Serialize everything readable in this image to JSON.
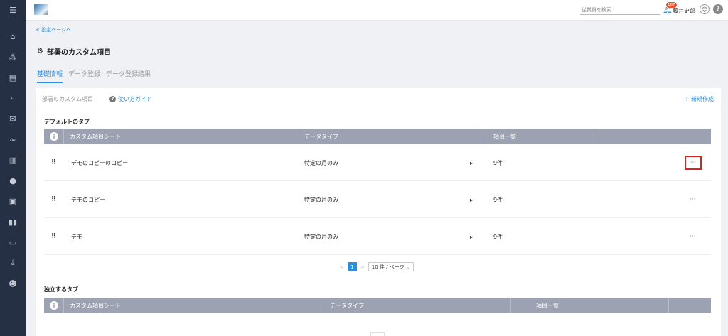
{
  "rail": {
    "icons": [
      "menu-icon",
      "home-icon",
      "org-chart-icon",
      "document-icon",
      "search-icon",
      "chat-icon",
      "link-icon",
      "chart-icon",
      "info-icon",
      "contact-card-icon",
      "book-icon",
      "mail-icon",
      "download-icon",
      "user-settings-icon"
    ]
  },
  "header": {
    "search_placeholder": "従業員を検索",
    "notification_count": "187",
    "user_name": "藤井史郎"
  },
  "breadcrumb": {
    "back_label": "< 設定ページへ"
  },
  "page": {
    "title": "部署のカスタム項目"
  },
  "tabs": [
    {
      "label": "基礎情報",
      "active": true
    },
    {
      "label": "データ登録",
      "active": false
    },
    {
      "label": "データ登録結果",
      "active": false
    }
  ],
  "card": {
    "title": "部署のカスタム項目",
    "guide_label": "使い方ガイド",
    "new_label": "+ 新規作成"
  },
  "default_section": {
    "title": "デフォルトのタブ",
    "columns": [
      "カスタム項目シート",
      "データタイプ",
      "項目一覧"
    ],
    "rows": [
      {
        "name": "デモのコピーのコピー",
        "type": "特定の月のみ",
        "count": "9件",
        "more": "···"
      },
      {
        "name": "デモのコピー",
        "type": "特定の月のみ",
        "count": "9件",
        "more": "···"
      },
      {
        "name": "デモ",
        "type": "特定の月のみ",
        "count": "9件",
        "more": "···"
      }
    ]
  },
  "pagination": {
    "prev": "<",
    "current": "1",
    "next": ">",
    "page_size": "10 件 / ページ"
  },
  "independent_section": {
    "title": "独立するタブ",
    "columns": [
      "カスタム項目シート",
      "データタイプ",
      "項目一覧"
    ]
  }
}
